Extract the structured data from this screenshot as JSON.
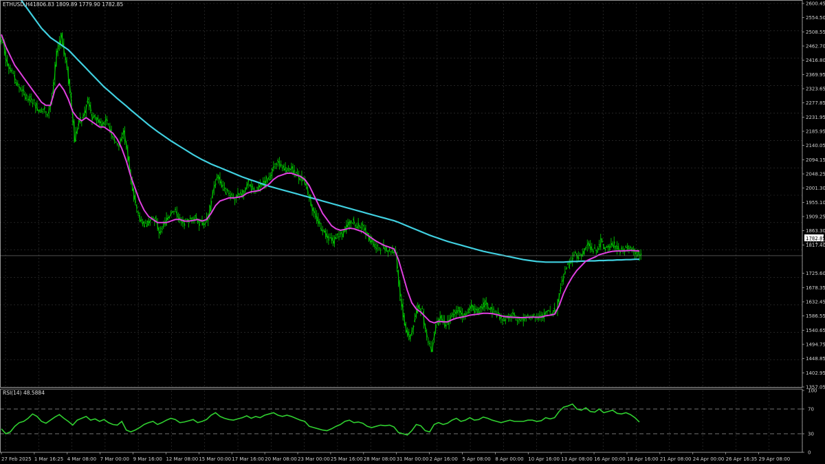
{
  "main_panel": {
    "symbol_label": "ETHUSD,H4",
    "ohlc_label": "1806.83 1809.89 1779.90 1782.85",
    "current_price_label": "1782.85",
    "hidden_price_label": "1771.50"
  },
  "rsi_panel": {
    "label": "RSI(14) 48.5884"
  },
  "colors": {
    "background": "#000000",
    "grid": "#3a3a3a",
    "candle": "#00c800",
    "ma_fast": "#e040e0",
    "ma_slow": "#40d0e0",
    "rsi_line": "#30d030",
    "price_line": "#808080"
  },
  "chart_data": [
    {
      "type": "line",
      "subtype": "candlestick",
      "symbol": "ETHUSD",
      "timeframe": "H4",
      "ylim": [
        1357.05,
        2600.45
      ],
      "y_ticks": [
        "2600.45",
        "2554.50",
        "2508.55",
        "2462.70",
        "2416.80",
        "2369.95",
        "2323.65",
        "2277.85",
        "2231.95",
        "2185.95",
        "2140.05",
        "2094.15",
        "2048.25",
        "2001.30",
        "1955.10",
        "1909.25",
        "1863.30",
        "1817.40",
        "1771.50",
        "1725.60",
        "1678.35",
        "1632.45",
        "1586.55",
        "1540.65",
        "1494.75",
        "1448.85",
        "1402.95",
        "1357.05"
      ],
      "x_ticks": [
        "27 Feb 2025",
        "1 Mar 16:25",
        "4 Mar 08:00",
        "7 Mar 00:00",
        "9 Mar 16:00",
        "12 Mar 08:00",
        "15 Mar 00:00",
        "17 Mar 16:00",
        "20 Mar 08:00",
        "23 Mar 00:00",
        "25 Mar 16:00",
        "28 Mar 08:00",
        "31 Mar 00:00",
        "2 Apr 16:00",
        "5 Apr 08:00",
        "8 Apr 00:00",
        "10 Apr 16:00",
        "13 Apr 08:00",
        "16 Apr 00:00",
        "18 Apr 16:00",
        "21 Apr 08:00",
        "24 Apr 00:00",
        "26 Apr 16:35",
        "29 Apr 08:00"
      ],
      "close": [
        2470,
        2400,
        2380,
        2340,
        2320,
        2300,
        2290,
        2280,
        2250,
        2260,
        2245,
        2300,
        2440,
        2500,
        2420,
        2310,
        2160,
        2220,
        2230,
        2290,
        2230,
        2230,
        2210,
        2220,
        2190,
        2160,
        2140,
        2190,
        2100,
        1990,
        1930,
        1890,
        1880,
        1900,
        1900,
        1860,
        1880,
        1910,
        1930,
        1920,
        1890,
        1890,
        1900,
        1910,
        1890,
        1890,
        1910,
        1990,
        2040,
        2010,
        1990,
        1980,
        1970,
        1980,
        1990,
        2020,
        1990,
        2000,
        2010,
        2030,
        2040,
        2090,
        2080,
        2060,
        2070,
        2060,
        2040,
        2030,
        2010,
        1950,
        1910,
        1880,
        1860,
        1840,
        1830,
        1850,
        1850,
        1880,
        1900,
        1880,
        1880,
        1870,
        1840,
        1820,
        1810,
        1810,
        1800,
        1800,
        1790,
        1650,
        1560,
        1510,
        1560,
        1620,
        1600,
        1510,
        1480,
        1560,
        1580,
        1560,
        1570,
        1600,
        1610,
        1590,
        1600,
        1620,
        1600,
        1610,
        1630,
        1610,
        1600,
        1590,
        1580,
        1580,
        1590,
        1580,
        1580,
        1580,
        1590,
        1590,
        1580,
        1590,
        1610,
        1600,
        1610,
        1690,
        1740,
        1760,
        1790,
        1780,
        1790,
        1820,
        1800,
        1800,
        1830,
        1800,
        1810,
        1820,
        1800,
        1800,
        1810,
        1800,
        1790,
        1783
      ],
      "series": [
        {
          "name": "",
          "kind": "ma_fast",
          "values": [
            2500,
            2460,
            2430,
            2400,
            2380,
            2360,
            2340,
            2320,
            2300,
            2280,
            2270,
            2270,
            2320,
            2340,
            2320,
            2290,
            2250,
            2230,
            2220,
            2230,
            2220,
            2210,
            2200,
            2200,
            2190,
            2180,
            2160,
            2130,
            2090,
            2040,
            2000,
            1960,
            1930,
            1910,
            1900,
            1890,
            1890,
            1890,
            1895,
            1900,
            1900,
            1895,
            1895,
            1897,
            1900,
            1895,
            1900,
            1920,
            1945,
            1960,
            1965,
            1970,
            1970,
            1972,
            1975,
            1985,
            1990,
            1992,
            1995,
            2005,
            2015,
            2030,
            2040,
            2045,
            2050,
            2050,
            2045,
            2040,
            2030,
            2010,
            1980,
            1950,
            1920,
            1900,
            1880,
            1870,
            1865,
            1868,
            1872,
            1870,
            1865,
            1860,
            1850,
            1840,
            1830,
            1822,
            1815,
            1810,
            1805,
            1770,
            1720,
            1670,
            1630,
            1610,
            1600,
            1585,
            1570,
            1565,
            1570,
            1568,
            1568,
            1575,
            1580,
            1583,
            1586,
            1590,
            1592,
            1594,
            1596,
            1596,
            1595,
            1592,
            1588,
            1585,
            1584,
            1583,
            1582,
            1582,
            1583,
            1584,
            1583,
            1584,
            1588,
            1590,
            1593,
            1620,
            1660,
            1690,
            1715,
            1735,
            1750,
            1765,
            1772,
            1778,
            1786,
            1790,
            1794,
            1797,
            1798,
            1798,
            1799,
            1800,
            1799,
            1798
          ]
        },
        {
          "name": "",
          "kind": "ma_slow",
          "values": [
            2700,
            2680,
            2660,
            2640,
            2620,
            2600,
            2580,
            2560,
            2540,
            2520,
            2505,
            2490,
            2480,
            2470,
            2460,
            2450,
            2435,
            2420,
            2405,
            2390,
            2375,
            2360,
            2345,
            2330,
            2318,
            2305,
            2292,
            2280,
            2268,
            2255,
            2243,
            2231,
            2219,
            2207,
            2196,
            2185,
            2175,
            2165,
            2155,
            2146,
            2137,
            2128,
            2119,
            2110,
            2102,
            2094,
            2087,
            2080,
            2074,
            2068,
            2062,
            2056,
            2050,
            2044,
            2038,
            2033,
            2028,
            2023,
            2018,
            2013,
            2008,
            2004,
            2000,
            1996,
            1992,
            1988,
            1984,
            1980,
            1976,
            1972,
            1968,
            1964,
            1960,
            1956,
            1952,
            1948,
            1944,
            1940,
            1936,
            1932,
            1928,
            1924,
            1920,
            1916,
            1912,
            1908,
            1904,
            1900,
            1896,
            1891,
            1885,
            1879,
            1873,
            1867,
            1861,
            1855,
            1849,
            1844,
            1839,
            1834,
            1829,
            1825,
            1821,
            1817,
            1813,
            1809,
            1805,
            1801,
            1797,
            1794,
            1791,
            1788,
            1785,
            1782,
            1779,
            1776,
            1773,
            1770,
            1768,
            1766,
            1764,
            1763,
            1762,
            1762,
            1762,
            1762,
            1762,
            1763,
            1764,
            1764,
            1765,
            1765,
            1766,
            1766,
            1767,
            1767,
            1768,
            1768,
            1769,
            1769,
            1770,
            1770,
            1771,
            1771
          ]
        }
      ]
    },
    {
      "type": "line",
      "name": "RSI(14)",
      "ylim": [
        0,
        100
      ],
      "y_ticks": [
        "100",
        "70",
        "30",
        "0"
      ],
      "levels": [
        70,
        30
      ],
      "values": [
        38,
        30,
        33,
        42,
        48,
        50,
        55,
        62,
        58,
        50,
        47,
        52,
        57,
        61,
        55,
        50,
        44,
        52,
        55,
        58,
        52,
        54,
        50,
        53,
        48,
        45,
        44,
        50,
        36,
        33,
        36,
        40,
        45,
        48,
        50,
        45,
        48,
        52,
        55,
        53,
        48,
        49,
        51,
        53,
        48,
        50,
        53,
        60,
        64,
        58,
        55,
        53,
        52,
        54,
        56,
        59,
        55,
        58,
        56,
        60,
        62,
        64,
        60,
        58,
        60,
        58,
        55,
        52,
        50,
        42,
        40,
        38,
        36,
        35,
        38,
        42,
        45,
        50,
        52,
        48,
        49,
        47,
        42,
        40,
        42,
        44,
        43,
        44,
        41,
        32,
        30,
        28,
        35,
        45,
        43,
        35,
        33,
        45,
        48,
        45,
        47,
        52,
        55,
        50,
        52,
        56,
        52,
        53,
        57,
        55,
        52,
        50,
        48,
        50,
        52,
        50,
        50,
        50,
        52,
        52,
        50,
        51,
        56,
        54,
        56,
        66,
        73,
        75,
        78,
        70,
        68,
        72,
        66,
        65,
        70,
        64,
        66,
        68,
        63,
        62,
        64,
        61,
        56,
        49
      ]
    }
  ]
}
